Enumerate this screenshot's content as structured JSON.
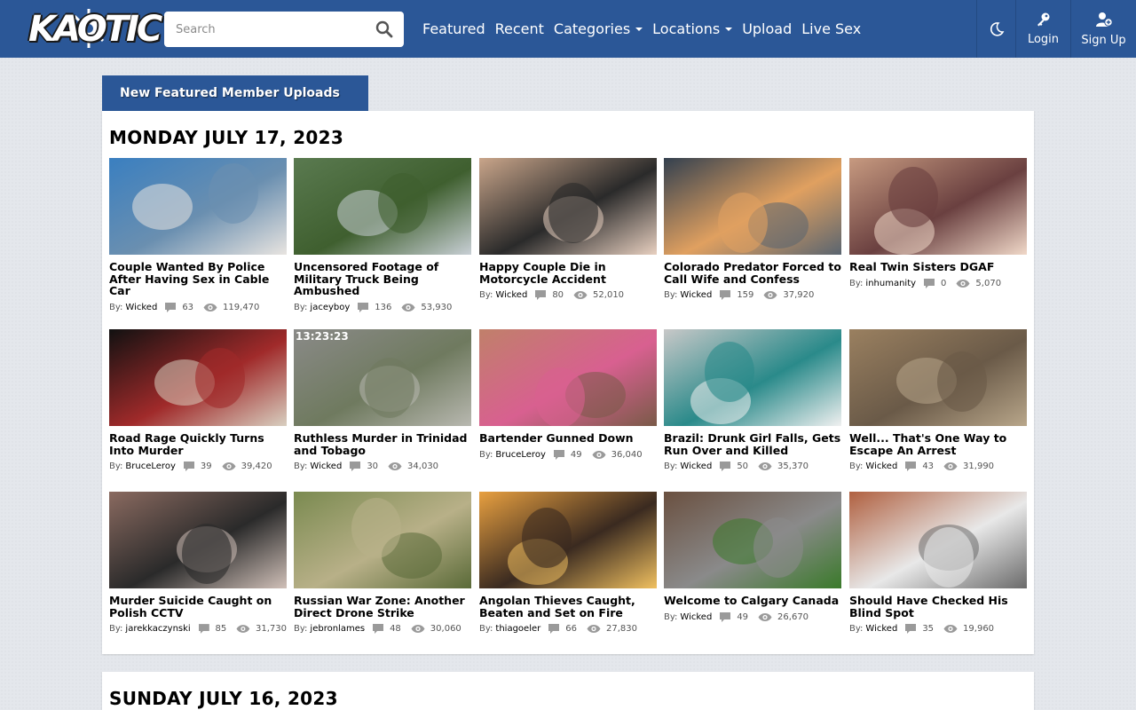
{
  "nav": {
    "logo": "KAOTIC",
    "search_placeholder": "Search",
    "links": [
      {
        "label": "Featured",
        "dropdown": false
      },
      {
        "label": "Recent",
        "dropdown": false
      },
      {
        "label": "Categories",
        "dropdown": true
      },
      {
        "label": "Locations",
        "dropdown": true
      },
      {
        "label": "Upload",
        "dropdown": false
      },
      {
        "label": "Live Sex",
        "dropdown": false
      }
    ],
    "login_label": "Login",
    "signup_label": "Sign Up"
  },
  "section_title": "New Featured Member Uploads",
  "days": [
    {
      "title": "MONDAY JULY 17, 2023",
      "videos": [
        {
          "title": "Couple Wanted By Police After Having Sex in Cable Car",
          "author": "Wicked",
          "comments": "63",
          "views": "119,470"
        },
        {
          "title": "Uncensored Footage of Military Truck Being Ambushed",
          "author": "jaceyboy",
          "comments": "136",
          "views": "53,930"
        },
        {
          "title": "Happy Couple Die in Motorcycle Accident",
          "author": "Wicked",
          "comments": "80",
          "views": "52,010"
        },
        {
          "title": "Colorado Predator Forced to Call Wife and Confess",
          "author": "Wicked",
          "comments": "159",
          "views": "37,920"
        },
        {
          "title": "Real Twin Sisters DGAF",
          "author": "inhumanity",
          "comments": "0",
          "views": "5,070"
        },
        {
          "title": "Road Rage Quickly Turns Into Murder",
          "author": "BruceLeroy",
          "comments": "39",
          "views": "39,420"
        },
        {
          "title": "Ruthless Murder in Trinidad and Tobago",
          "author": "Wicked",
          "comments": "30",
          "views": "34,030"
        },
        {
          "title": "Bartender Gunned Down",
          "author": "BruceLeroy",
          "comments": "49",
          "views": "36,040"
        },
        {
          "title": "Brazil: Drunk Girl Falls, Gets Run Over and Killed",
          "author": "Wicked",
          "comments": "50",
          "views": "35,370"
        },
        {
          "title": "Well... That's One Way to Escape An Arrest",
          "author": "Wicked",
          "comments": "43",
          "views": "31,990"
        },
        {
          "title": "Murder Suicide Caught on Polish CCTV",
          "author": "jarekkaczynski",
          "comments": "85",
          "views": "31,730"
        },
        {
          "title": "Russian War Zone: Another Direct Drone Strike",
          "author": "jebronlames",
          "comments": "48",
          "views": "30,060"
        },
        {
          "title": "Angolan Thieves Caught, Beaten and Set on Fire",
          "author": "thiagoeler",
          "comments": "66",
          "views": "27,830"
        },
        {
          "title": "Welcome to Calgary Canada",
          "author": "Wicked",
          "comments": "49",
          "views": "26,670"
        },
        {
          "title": "Should Have Checked His Blind Spot",
          "author": "Wicked",
          "comments": "35",
          "views": "19,960"
        }
      ]
    },
    {
      "title": "SUNDAY JULY 16, 2023",
      "videos": []
    }
  ],
  "by_label": "By:",
  "thumb_overlay_text": "13:23:23",
  "colors": {
    "navbar": "#2b5797",
    "page_bg": "#e4e7ec",
    "panel": "#ffffff"
  }
}
